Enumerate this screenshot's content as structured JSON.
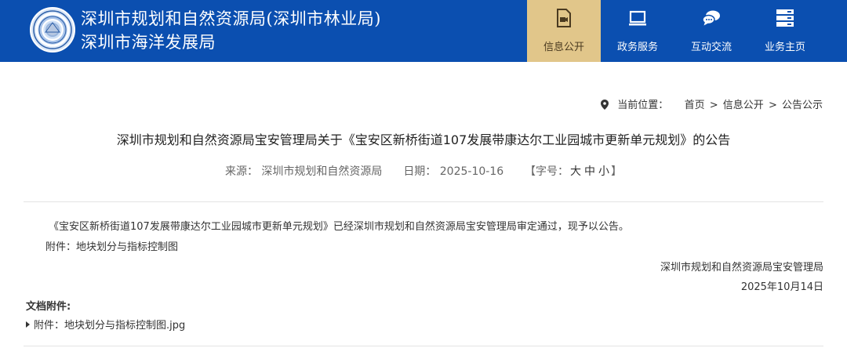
{
  "header": {
    "org_line1": "深圳市规划和自然资源局(深圳市林业局)",
    "org_line2": "深圳市海洋发展局",
    "logo_icon": "municipal-seal-logo",
    "colors": {
      "header_bg": "#0b4fb0",
      "active_tab_bg": "#e1c68a"
    }
  },
  "nav": {
    "items": [
      {
        "label": "信息公开",
        "icon": "video-file-icon",
        "active": true
      },
      {
        "label": "政务服务",
        "icon": "monitor-icon",
        "active": false
      },
      {
        "label": "互动交流",
        "icon": "chat-bubble-icon",
        "active": false
      },
      {
        "label": "业务主页",
        "icon": "server-icon",
        "active": false
      }
    ]
  },
  "breadcrumb": {
    "prefix": "当前位置：",
    "items": [
      "首页",
      "信息公开",
      "公告公示"
    ],
    "separator": ">"
  },
  "article": {
    "title": "深圳市规划和自然资源局宝安管理局关于《宝安区新桥街道107发展带康达尔工业园城市更新单元规划》的公告",
    "source_label": "来源：",
    "source": "深圳市规划和自然资源局",
    "date_label": "日期：",
    "date": "2025-10-16",
    "fontsize_prefix": "【字号：",
    "fontsize_large": "大",
    "fontsize_medium": "中",
    "fontsize_small": "小",
    "fontsize_suffix": "】",
    "body": "《宝安区新桥街道107发展带康达尔工业园城市更新单元规划》已经深圳市规划和自然资源局宝安管理局审定通过，现予以公告。",
    "attachment_line": "附件：地块划分与指标控制图",
    "sign_org": "深圳市规划和自然资源局宝安管理局",
    "sign_date": "2025年10月14日"
  },
  "documents": {
    "heading": "文档附件:",
    "files": [
      "附件：地块划分与指标控制图.jpg"
    ]
  }
}
